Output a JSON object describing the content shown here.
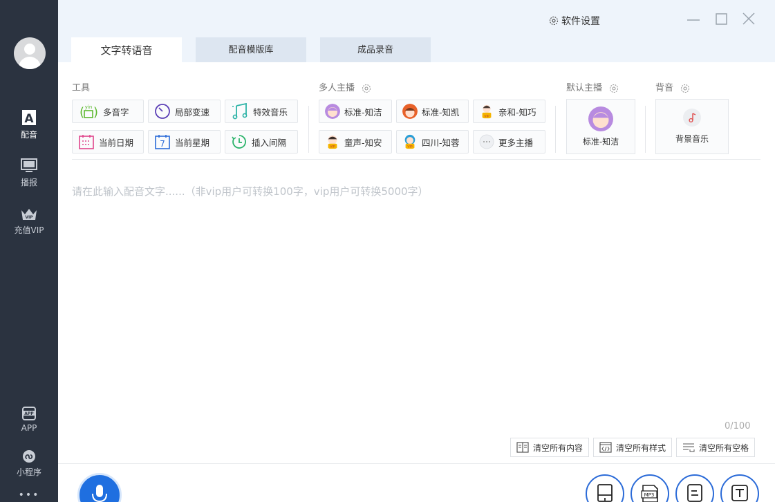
{
  "window": {
    "settings_label": "软件设置"
  },
  "sidebar": {
    "items": [
      {
        "label": "配音",
        "icon": "a-letter-icon"
      },
      {
        "label": "播报",
        "icon": "monitor-icon"
      },
      {
        "label": "充值VIP",
        "icon": "vip-crown-icon"
      },
      {
        "label": "APP",
        "icon": "app-icon"
      },
      {
        "label": "小程序",
        "icon": "miniprogram-icon"
      }
    ],
    "more": "•••"
  },
  "tabs": [
    {
      "label": "文字转语音"
    },
    {
      "label": "配音模版库"
    },
    {
      "label": "成品录音"
    }
  ],
  "sections": {
    "tools": "工具",
    "anchors": "多人主播",
    "default_anchor": "默认主播",
    "bgm": "背音"
  },
  "tools": [
    {
      "label": "多音字",
      "icon_text": "yin"
    },
    {
      "label": "局部变速"
    },
    {
      "label": "特效音乐"
    },
    {
      "label": "当前日期"
    },
    {
      "label": "当前星期",
      "icon_text": "7"
    },
    {
      "label": "插入间隔"
    }
  ],
  "anchors": [
    {
      "label": "标准-知洁"
    },
    {
      "label": "标准-知凯"
    },
    {
      "label": "亲和-知巧",
      "badge": "VIP"
    },
    {
      "label": "童声-知安",
      "badge": "VIP"
    },
    {
      "label": "四川-知蓉",
      "badge": "VIP"
    },
    {
      "label": "更多主播"
    }
  ],
  "default_anchor": {
    "label": "标准-知洁"
  },
  "bgm": {
    "label": "背景音乐"
  },
  "editor": {
    "placeholder": "请在此输入配音文字......（非vip用户可转换100字，vip用户可转换5000字）",
    "counter": "0/100"
  },
  "actions": {
    "clear_content": "清空所有内容",
    "clear_style": "清空所有样式",
    "clear_space": "清空所有空格"
  },
  "bottom_icons": [
    "save-icon",
    "mp3-icon",
    "subtitle-icon",
    "text-icon"
  ],
  "colors": {
    "sidebar": "#2b3340",
    "accent": "#2b6bd8",
    "topbar": "#eef4fb"
  }
}
